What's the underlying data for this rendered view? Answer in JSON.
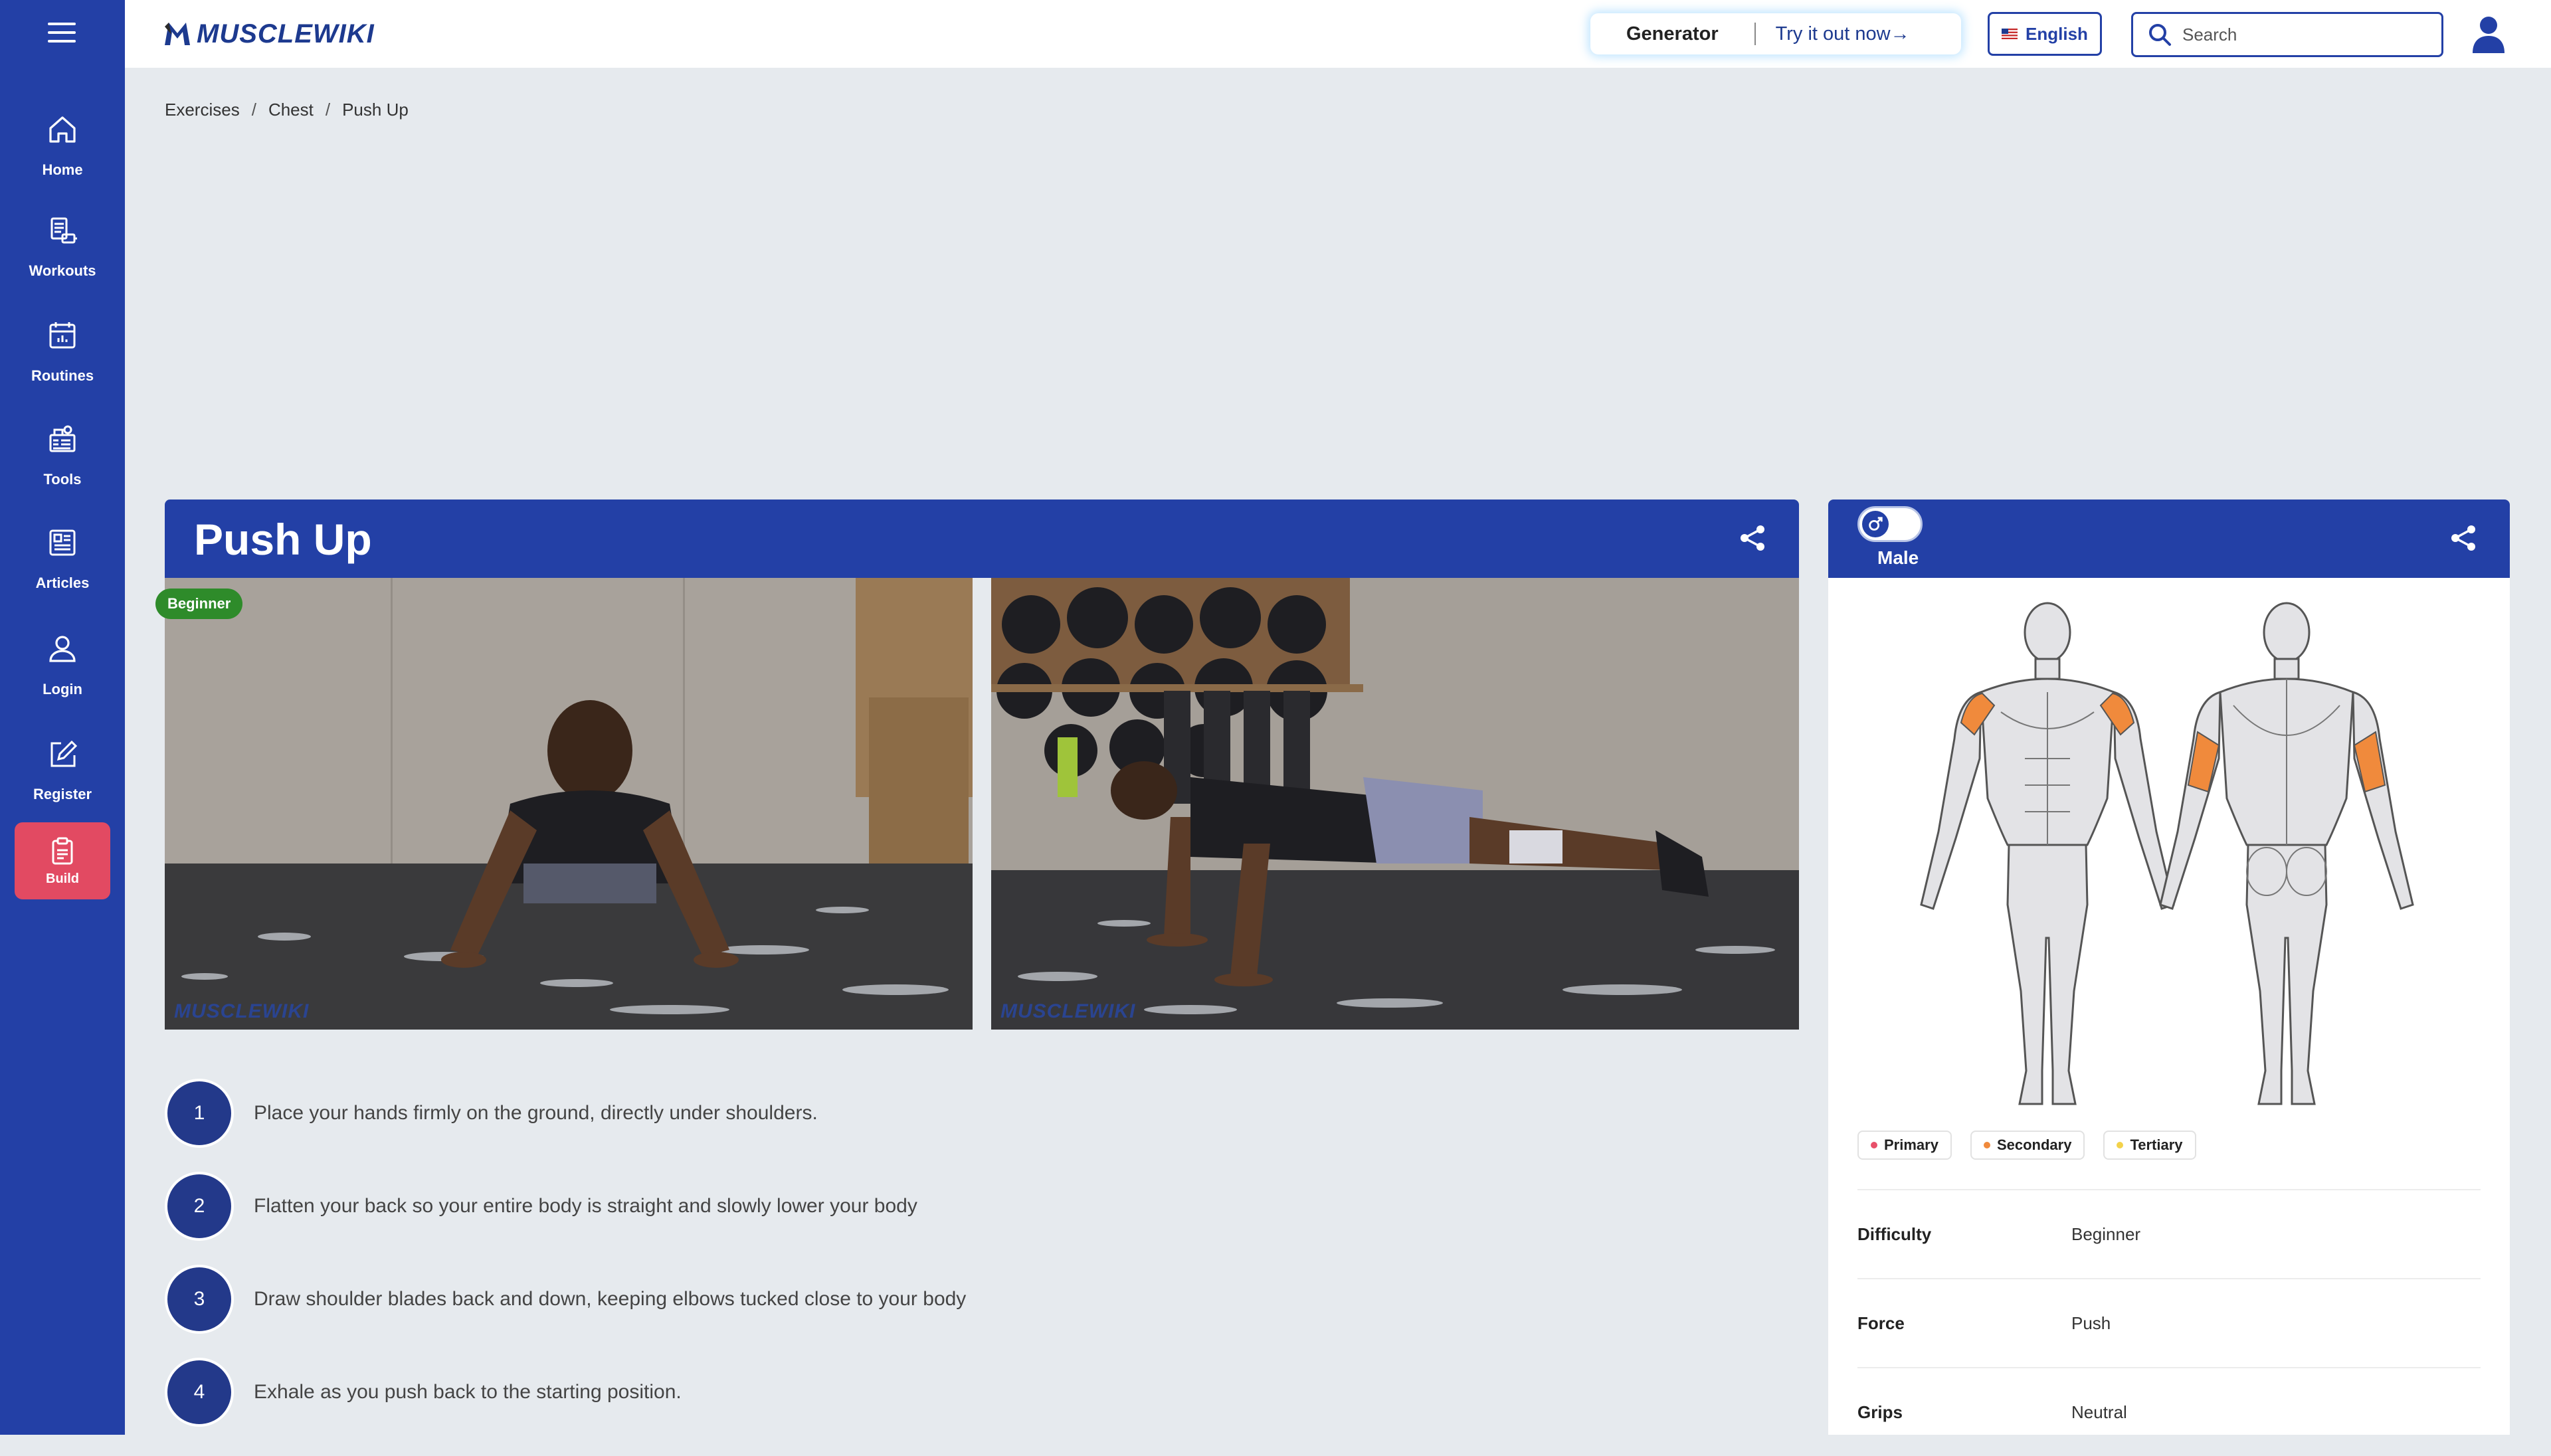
{
  "brand": {
    "name": "MUSCLEWIKI"
  },
  "sidebar": {
    "items": [
      {
        "label": "Home",
        "icon": "home-icon"
      },
      {
        "label": "Workouts",
        "icon": "workouts-icon"
      },
      {
        "label": "Routines",
        "icon": "calendar-icon"
      },
      {
        "label": "Tools",
        "icon": "tools-icon"
      },
      {
        "label": "Articles",
        "icon": "articles-icon"
      },
      {
        "label": "Login",
        "icon": "user-icon"
      },
      {
        "label": "Register",
        "icon": "edit-icon"
      },
      {
        "label": "Build",
        "icon": "clipboard-icon"
      }
    ]
  },
  "topbar": {
    "generator_title": "Generator",
    "generator_link": "Try it out now→",
    "language": "English",
    "search_placeholder": "Search"
  },
  "breadcrumb": [
    "Exercises",
    "Chest",
    "Push Up"
  ],
  "exercise": {
    "title": "Push Up",
    "difficulty_badge": "Beginner",
    "video_watermark": "MUSCLEWIKI",
    "steps": [
      {
        "num": "1",
        "text": "Place your hands firmly on the ground, directly under shoulders."
      },
      {
        "num": "2",
        "text": "Flatten your back so your entire body is straight and slowly lower your body"
      },
      {
        "num": "3",
        "text": "Draw shoulder blades back and down, keeping elbows tucked close to your body"
      },
      {
        "num": "4",
        "text": "Exhale as you push back to the starting position."
      }
    ]
  },
  "side": {
    "gender_label": "Male",
    "legend": [
      {
        "label": "Primary",
        "color": "#e8506a"
      },
      {
        "label": "Secondary",
        "color": "#f08a3c"
      },
      {
        "label": "Tertiary",
        "color": "#f3d24a"
      }
    ],
    "properties": [
      {
        "key": "Difficulty",
        "value": "Beginner"
      },
      {
        "key": "Force",
        "value": "Push"
      },
      {
        "key": "Grips",
        "value": "Neutral"
      }
    ]
  },
  "colors": {
    "brand_blue": "#2340a6",
    "build_pink": "#e24a62",
    "badge_green": "#2e8b2a",
    "muscle_highlight": "#f08a3c"
  }
}
